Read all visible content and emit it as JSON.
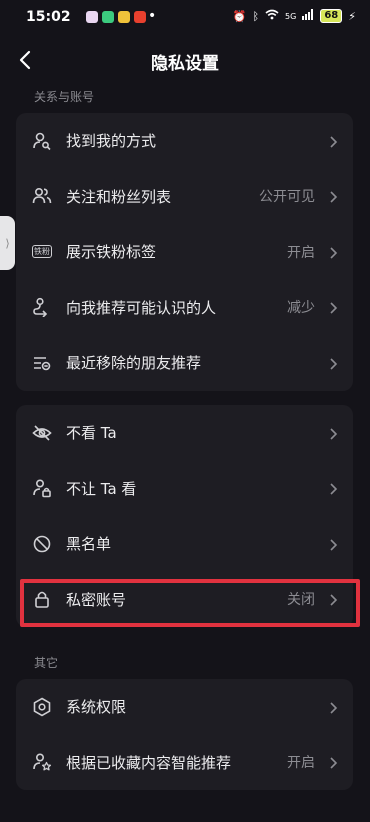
{
  "status_bar": {
    "time": "15:02",
    "battery": "68",
    "network": "5G"
  },
  "header": {
    "title": "隐私设置"
  },
  "sections": [
    {
      "label": "关系与账号",
      "rows": [
        {
          "label": "找到我的方式",
          "value": ""
        },
        {
          "label": "关注和粉丝列表",
          "value": "公开可见"
        },
        {
          "label": "展示铁粉标签",
          "value": "开启",
          "icon_text": "铁粉"
        },
        {
          "label": "向我推荐可能认识的人",
          "value": "减少"
        },
        {
          "label": "最近移除的朋友推荐",
          "value": ""
        }
      ]
    },
    {
      "label": "",
      "rows": [
        {
          "label": "不看 Ta",
          "value": ""
        },
        {
          "label": "不让 Ta 看",
          "value": ""
        },
        {
          "label": "黑名单",
          "value": ""
        },
        {
          "label": "私密账号",
          "value": "关闭"
        }
      ]
    },
    {
      "label": "其它",
      "rows": [
        {
          "label": "系统权限",
          "value": ""
        },
        {
          "label": "根据已收藏内容智能推荐",
          "value": "开启"
        }
      ]
    }
  ],
  "colors": {
    "background": "#141319",
    "card": "#1E1D23",
    "highlight": "#E1323F"
  },
  "icons": [
    "back-arrow-icon",
    "user-search-icon",
    "users-icon",
    "tie-fan-badge-icon",
    "person-route-icon",
    "list-remove-icon",
    "eye-off-icon",
    "user-lock-icon",
    "block-icon",
    "lock-icon",
    "hexagon-settings-icon",
    "user-star-icon",
    "chevron-right-icon"
  ]
}
